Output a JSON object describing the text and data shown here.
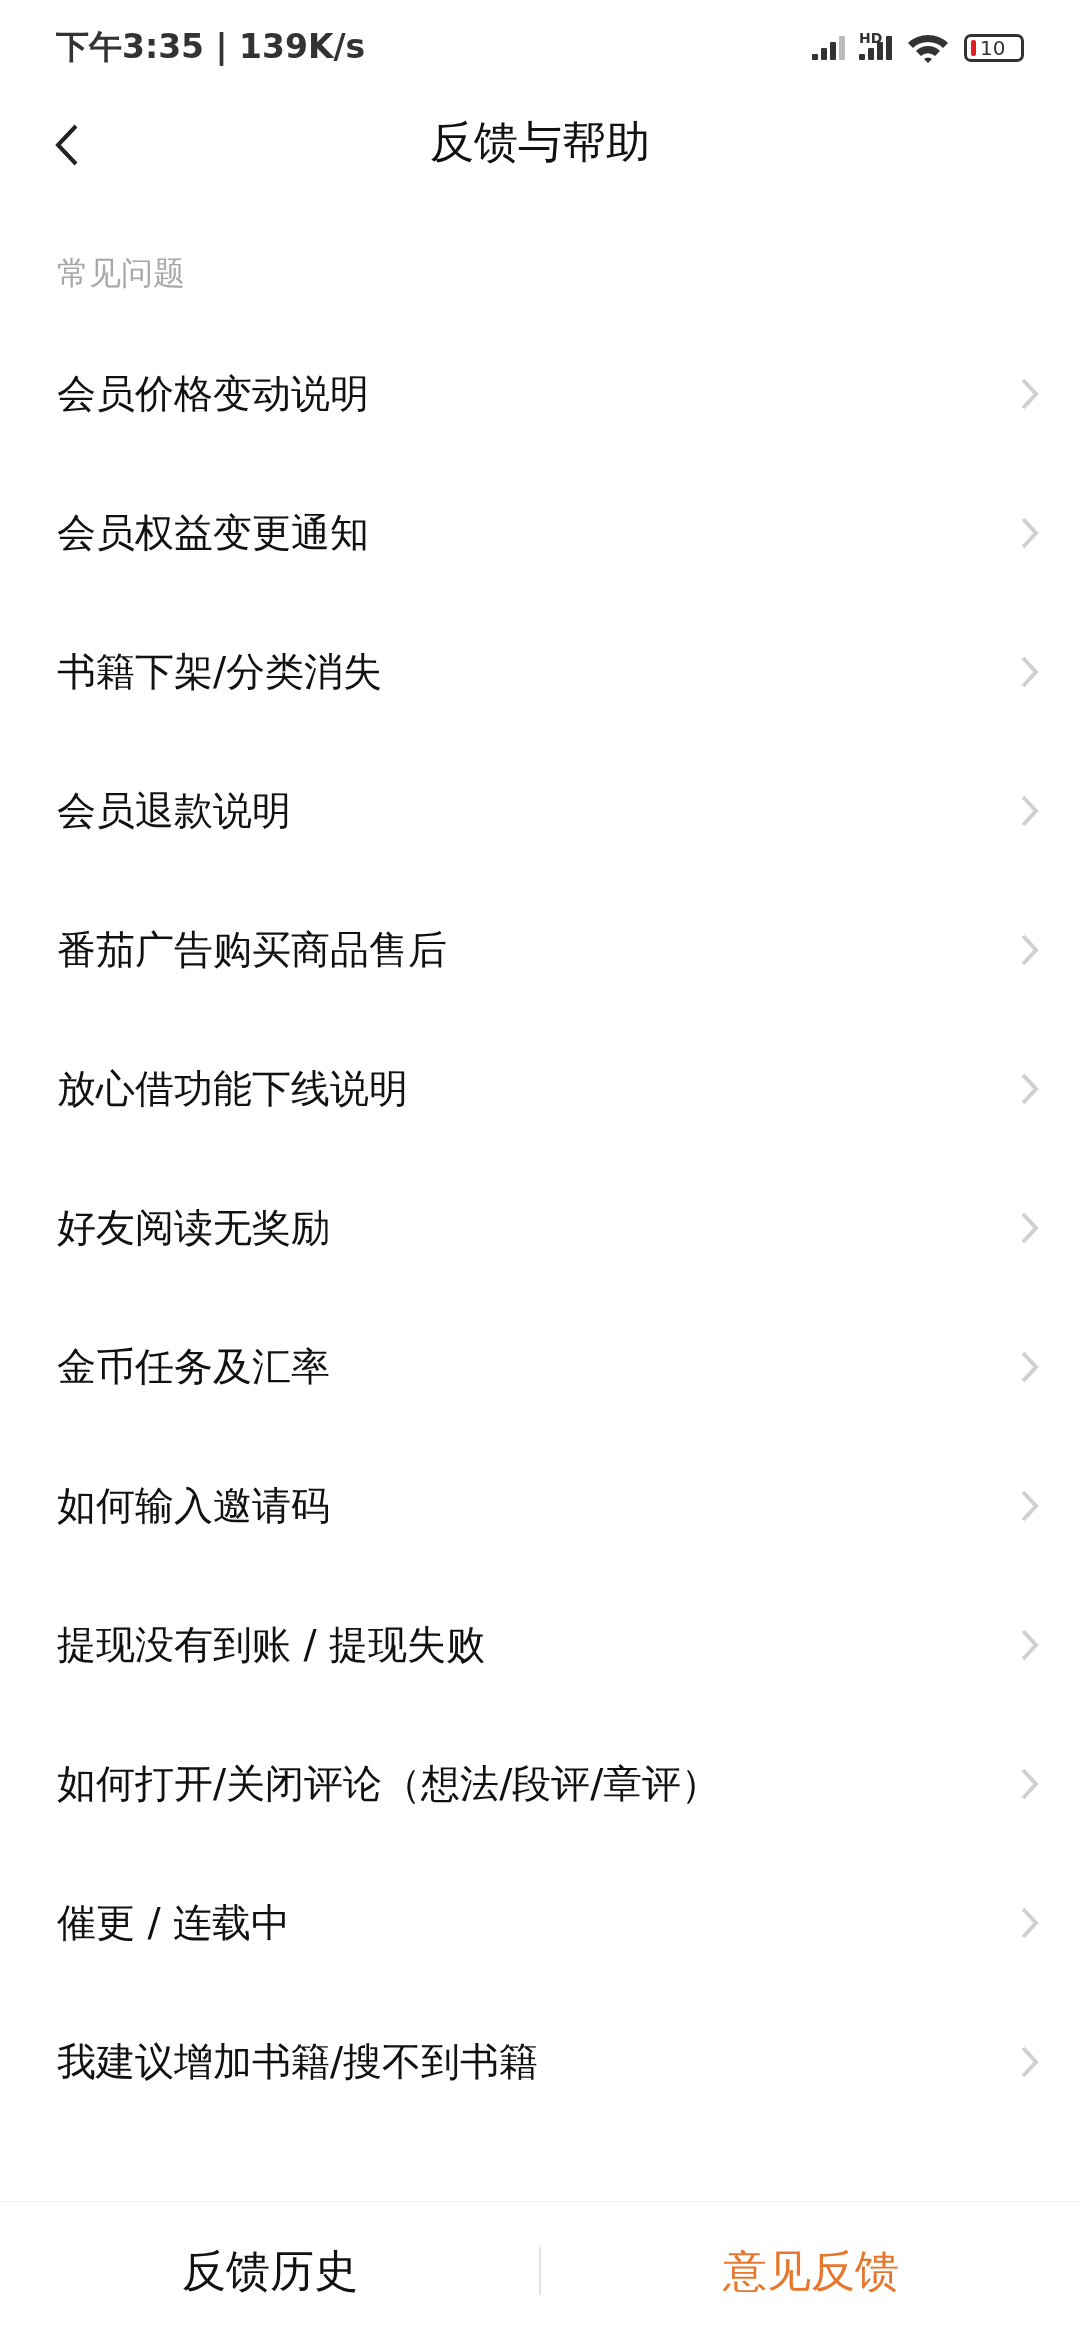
{
  "status_bar": {
    "time": "下午3:35 | 139K/s",
    "network_label": "HD",
    "battery": "10"
  },
  "header": {
    "title": "反馈与帮助"
  },
  "section": {
    "title": "常见问题"
  },
  "faq_items": [
    {
      "label": "会员价格变动说明"
    },
    {
      "label": "会员权益变更通知"
    },
    {
      "label": "书籍下架/分类消失"
    },
    {
      "label": "会员退款说明"
    },
    {
      "label": "番茄广告购买商品售后"
    },
    {
      "label": "放心借功能下线说明"
    },
    {
      "label": "好友阅读无奖励"
    },
    {
      "label": "金币任务及汇率"
    },
    {
      "label": "如何输入邀请码"
    },
    {
      "label": "提现没有到账 / 提现失败"
    },
    {
      "label": "如何打开/关闭评论（想法/段评/章评）"
    },
    {
      "label": "催更 / 连载中"
    },
    {
      "label": "我建议增加书籍/搜不到书籍"
    }
  ],
  "bottom_bar": [
    {
      "label": "反馈历史",
      "kind": "secondary"
    },
    {
      "label": "意见反馈",
      "kind": "primary"
    }
  ]
}
